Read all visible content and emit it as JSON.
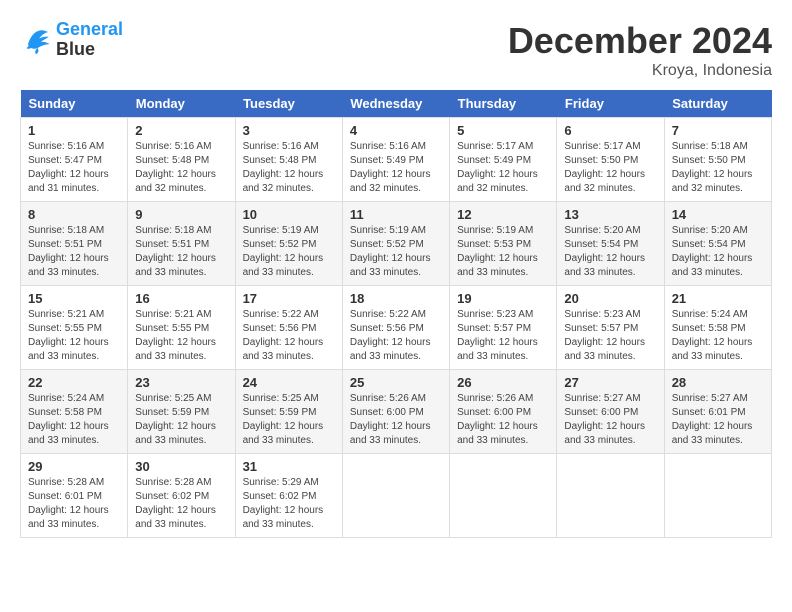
{
  "logo": {
    "line1": "General",
    "line2": "Blue"
  },
  "title": "December 2024",
  "location": "Kroya, Indonesia",
  "days_of_week": [
    "Sunday",
    "Monday",
    "Tuesday",
    "Wednesday",
    "Thursday",
    "Friday",
    "Saturday"
  ],
  "weeks": [
    [
      {
        "day": "1",
        "info": "Sunrise: 5:16 AM\nSunset: 5:47 PM\nDaylight: 12 hours\nand 31 minutes."
      },
      {
        "day": "2",
        "info": "Sunrise: 5:16 AM\nSunset: 5:48 PM\nDaylight: 12 hours\nand 32 minutes."
      },
      {
        "day": "3",
        "info": "Sunrise: 5:16 AM\nSunset: 5:48 PM\nDaylight: 12 hours\nand 32 minutes."
      },
      {
        "day": "4",
        "info": "Sunrise: 5:16 AM\nSunset: 5:49 PM\nDaylight: 12 hours\nand 32 minutes."
      },
      {
        "day": "5",
        "info": "Sunrise: 5:17 AM\nSunset: 5:49 PM\nDaylight: 12 hours\nand 32 minutes."
      },
      {
        "day": "6",
        "info": "Sunrise: 5:17 AM\nSunset: 5:50 PM\nDaylight: 12 hours\nand 32 minutes."
      },
      {
        "day": "7",
        "info": "Sunrise: 5:18 AM\nSunset: 5:50 PM\nDaylight: 12 hours\nand 32 minutes."
      }
    ],
    [
      {
        "day": "8",
        "info": "Sunrise: 5:18 AM\nSunset: 5:51 PM\nDaylight: 12 hours\nand 33 minutes."
      },
      {
        "day": "9",
        "info": "Sunrise: 5:18 AM\nSunset: 5:51 PM\nDaylight: 12 hours\nand 33 minutes."
      },
      {
        "day": "10",
        "info": "Sunrise: 5:19 AM\nSunset: 5:52 PM\nDaylight: 12 hours\nand 33 minutes."
      },
      {
        "day": "11",
        "info": "Sunrise: 5:19 AM\nSunset: 5:52 PM\nDaylight: 12 hours\nand 33 minutes."
      },
      {
        "day": "12",
        "info": "Sunrise: 5:19 AM\nSunset: 5:53 PM\nDaylight: 12 hours\nand 33 minutes."
      },
      {
        "day": "13",
        "info": "Sunrise: 5:20 AM\nSunset: 5:54 PM\nDaylight: 12 hours\nand 33 minutes."
      },
      {
        "day": "14",
        "info": "Sunrise: 5:20 AM\nSunset: 5:54 PM\nDaylight: 12 hours\nand 33 minutes."
      }
    ],
    [
      {
        "day": "15",
        "info": "Sunrise: 5:21 AM\nSunset: 5:55 PM\nDaylight: 12 hours\nand 33 minutes."
      },
      {
        "day": "16",
        "info": "Sunrise: 5:21 AM\nSunset: 5:55 PM\nDaylight: 12 hours\nand 33 minutes."
      },
      {
        "day": "17",
        "info": "Sunrise: 5:22 AM\nSunset: 5:56 PM\nDaylight: 12 hours\nand 33 minutes."
      },
      {
        "day": "18",
        "info": "Sunrise: 5:22 AM\nSunset: 5:56 PM\nDaylight: 12 hours\nand 33 minutes."
      },
      {
        "day": "19",
        "info": "Sunrise: 5:23 AM\nSunset: 5:57 PM\nDaylight: 12 hours\nand 33 minutes."
      },
      {
        "day": "20",
        "info": "Sunrise: 5:23 AM\nSunset: 5:57 PM\nDaylight: 12 hours\nand 33 minutes."
      },
      {
        "day": "21",
        "info": "Sunrise: 5:24 AM\nSunset: 5:58 PM\nDaylight: 12 hours\nand 33 minutes."
      }
    ],
    [
      {
        "day": "22",
        "info": "Sunrise: 5:24 AM\nSunset: 5:58 PM\nDaylight: 12 hours\nand 33 minutes."
      },
      {
        "day": "23",
        "info": "Sunrise: 5:25 AM\nSunset: 5:59 PM\nDaylight: 12 hours\nand 33 minutes."
      },
      {
        "day": "24",
        "info": "Sunrise: 5:25 AM\nSunset: 5:59 PM\nDaylight: 12 hours\nand 33 minutes."
      },
      {
        "day": "25",
        "info": "Sunrise: 5:26 AM\nSunset: 6:00 PM\nDaylight: 12 hours\nand 33 minutes."
      },
      {
        "day": "26",
        "info": "Sunrise: 5:26 AM\nSunset: 6:00 PM\nDaylight: 12 hours\nand 33 minutes."
      },
      {
        "day": "27",
        "info": "Sunrise: 5:27 AM\nSunset: 6:00 PM\nDaylight: 12 hours\nand 33 minutes."
      },
      {
        "day": "28",
        "info": "Sunrise: 5:27 AM\nSunset: 6:01 PM\nDaylight: 12 hours\nand 33 minutes."
      }
    ],
    [
      {
        "day": "29",
        "info": "Sunrise: 5:28 AM\nSunset: 6:01 PM\nDaylight: 12 hours\nand 33 minutes."
      },
      {
        "day": "30",
        "info": "Sunrise: 5:28 AM\nSunset: 6:02 PM\nDaylight: 12 hours\nand 33 minutes."
      },
      {
        "day": "31",
        "info": "Sunrise: 5:29 AM\nSunset: 6:02 PM\nDaylight: 12 hours\nand 33 minutes."
      },
      {
        "day": "",
        "info": ""
      },
      {
        "day": "",
        "info": ""
      },
      {
        "day": "",
        "info": ""
      },
      {
        "day": "",
        "info": ""
      }
    ]
  ]
}
